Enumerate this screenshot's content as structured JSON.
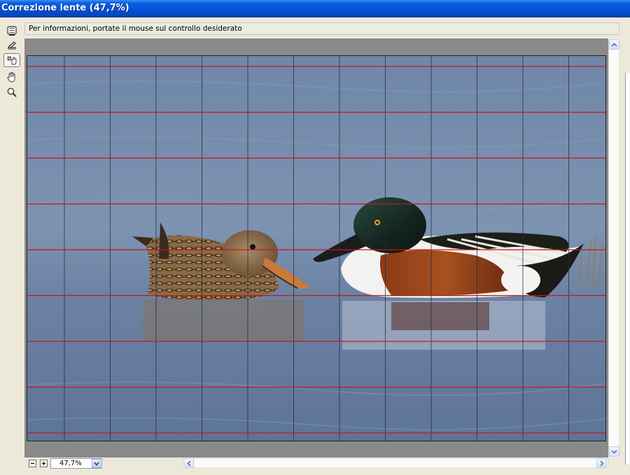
{
  "window": {
    "title": "Correzione lente (47,7%)"
  },
  "tools": [
    {
      "id": "remove-distortion",
      "icon": "remove-distortion-icon",
      "active": false
    },
    {
      "id": "straighten",
      "icon": "straighten-icon",
      "active": false
    },
    {
      "id": "move-grid",
      "icon": "move-grid-icon",
      "active": true
    },
    {
      "id": "hand",
      "icon": "hand-icon",
      "active": false
    },
    {
      "id": "zoom",
      "icon": "magnifier-icon",
      "active": false
    }
  ],
  "info": {
    "text": "Per informazioni, portate il mouse sul controllo desiderato"
  },
  "zoom": {
    "value": "47,7%"
  },
  "colors": {
    "grid_horizontal": "#c81818",
    "grid_vertical": "#1e2a3a",
    "workspace": "#8a8a8a"
  }
}
